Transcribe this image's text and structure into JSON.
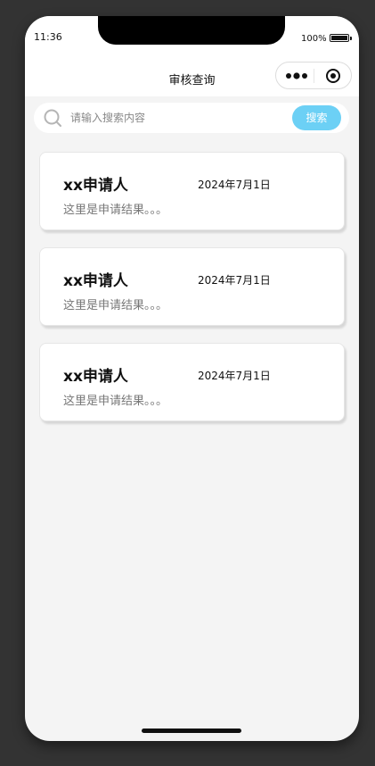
{
  "status_bar": {
    "time": "11:36",
    "battery_text": "100%",
    "battery_level": 1.0
  },
  "nav": {
    "title": "审核查询",
    "more_icon": "more-dots-icon",
    "close_icon": "target-circle-icon"
  },
  "search": {
    "placeholder": "请输入搜索内容",
    "value": "",
    "button_label": "搜索",
    "icon": "search-icon",
    "accent_color": "#6cd0f5"
  },
  "cards": [
    {
      "name": "xx申请人",
      "date": "2024年7月1日",
      "result": "这里是申请结果。。。"
    },
    {
      "name": "xx申请人",
      "date": "2024年7月1日",
      "result": "这里是申请结果。。。"
    },
    {
      "name": "xx申请人",
      "date": "2024年7月1日",
      "result": "这里是申请结果。。。"
    }
  ]
}
